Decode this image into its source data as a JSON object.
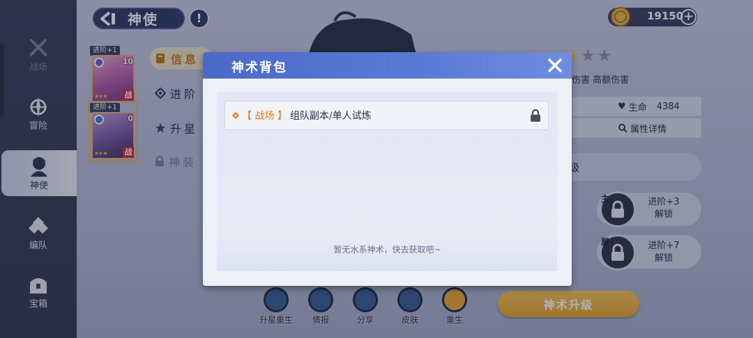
{
  "sidebar": {
    "items": [
      {
        "label": "战场",
        "icon": "crossed-swords-icon",
        "state": "disabled"
      },
      {
        "label": "冒险",
        "icon": "compass-icon",
        "state": "normal"
      },
      {
        "label": "神使",
        "icon": "hero-icon",
        "state": "active"
      },
      {
        "label": "编队",
        "icon": "formation-icon",
        "state": "normal"
      },
      {
        "label": "宝箱",
        "icon": "chest-icon",
        "state": "normal"
      }
    ]
  },
  "header": {
    "title": "神使",
    "info_glyph": "!",
    "coins": "19150",
    "plus_glyph": "+"
  },
  "cards": [
    {
      "badge": "进阶+1",
      "level": "10",
      "stars": "★★★",
      "tag": "战"
    },
    {
      "badge": "进阶+1",
      "level": "0",
      "stars": "★★★",
      "tag": "战"
    }
  ],
  "menu": {
    "info": "信息",
    "advance": "进阶",
    "star_up": "升星",
    "gear": "神装"
  },
  "right_panel": {
    "stars_filled": 3,
    "stars_total": 5,
    "damage_text": "伤害 高额伤害",
    "hp_label": "生命",
    "hp_value": "4384",
    "attr_detail": "属性详情",
    "level_label": "级",
    "slot1_tag": "主",
    "slot1_text": "进阶+3 解锁",
    "slot1_line1": "进阶+3",
    "slot1_line2": "解锁",
    "slot2_tag": "属",
    "slot2_line1": "进阶+7",
    "slot2_line2": "解锁",
    "upgrade_button": "神术升级"
  },
  "actions": [
    {
      "label": "升星重生"
    },
    {
      "label": "情报"
    },
    {
      "label": "分享"
    },
    {
      "label": "皮肤"
    },
    {
      "label": "重生"
    }
  ],
  "modal": {
    "title": "神术背包",
    "row": {
      "tag": "【 战场 】",
      "desc": "组队副本/单人试炼"
    },
    "empty_message": "暂无水系神术，快去获取吧~"
  },
  "colors": {
    "accent_blue": "#4a69c8",
    "accent_orange": "#e27a14",
    "button_gold": "#f0b240"
  }
}
